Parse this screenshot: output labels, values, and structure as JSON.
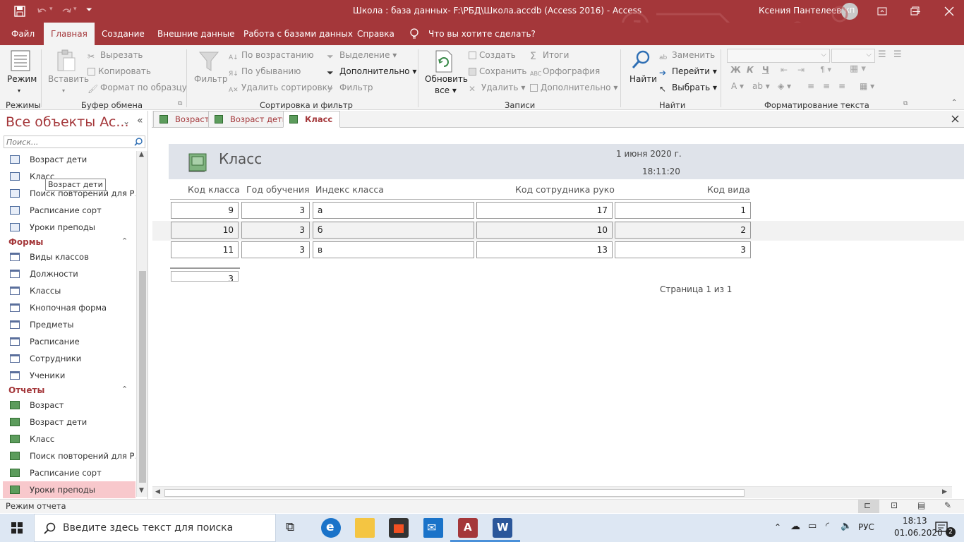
{
  "window": {
    "title": "Школа : база данных- F:\\РБД\\Школа.accdb (Access 2016)  -  Access",
    "user": "Ксения Пантелеева",
    "user_initials": "КП"
  },
  "ribbon_tabs": [
    "Файл",
    "Главная",
    "Создание",
    "Внешние данные",
    "Работа с базами данных",
    "Справка"
  ],
  "tell_me": "Что вы хотите сделать?",
  "ribbon": {
    "views": {
      "label": "Режим",
      "group": "Режимы"
    },
    "clipboard": {
      "paste": "Вставить",
      "cut": "Вырезать",
      "copy": "Копировать",
      "format_painter": "Формат по образцу",
      "group": "Буфер обмена"
    },
    "sort_filter": {
      "filter": "Фильтр",
      "asc": "По возрастанию",
      "desc": "По убыванию",
      "remove_sort": "Удалить сортировку",
      "selection": "Выделение",
      "advanced": "Дополнительно",
      "toggle_filter": "Фильтр",
      "group": "Сортировка и фильтр"
    },
    "records": {
      "refresh": "Обновить",
      "refresh2": "все",
      "new": "Создать",
      "save": "Сохранить",
      "delete": "Удалить",
      "totals": "Итоги",
      "spelling": "Орфография",
      "more": "Дополнительно",
      "group": "Записи"
    },
    "find": {
      "find": "Найти",
      "replace": "Заменить",
      "goto": "Перейти",
      "select": "Выбрать",
      "group": "Найти"
    },
    "text_format": {
      "group": "Форматирование текста",
      "bold": "Ж",
      "italic": "К",
      "underline": "Ч"
    }
  },
  "nav": {
    "title": "Все объекты Ac...",
    "search_placeholder": "Поиск...",
    "tooltip": "Возраст дети",
    "query_items": [
      "Возраст дети",
      "Класс",
      "Поиск повторений для Р...",
      "Расписание сорт",
      "Уроки преподы"
    ],
    "forms_header": "Формы",
    "form_items": [
      "Виды классов",
      "Должности",
      "Классы",
      "Кнопочная форма",
      "Предметы",
      "Расписание",
      "Сотрудники",
      "Ученики"
    ],
    "reports_header": "Отчеты",
    "report_items": [
      "Возраст",
      "Возраст дети",
      "Класс",
      "Поиск повторений для Р...",
      "Расписание сорт",
      "Уроки преподы"
    ]
  },
  "doc_tabs": [
    "Возраст",
    "Возраст дети",
    "Класс"
  ],
  "report": {
    "title": "Класс",
    "date": "1 июня 2020 г.",
    "time": "18:11:20",
    "columns": [
      "Код класса",
      "Год обучения",
      "Индекс класса",
      "Код сотрудника руко",
      "Код вида"
    ],
    "rows": [
      [
        "9",
        "3",
        "а",
        "17",
        "1"
      ],
      [
        "10",
        "3",
        "б",
        "10",
        "2"
      ],
      [
        "11",
        "3",
        "в",
        "13",
        "3"
      ]
    ],
    "count": "3",
    "page": "Страница 1 из 1"
  },
  "status": {
    "mode": "Режим отчета"
  },
  "taskbar": {
    "search": "Введите здесь текст для поиска",
    "lang": "РУС",
    "time": "18:13",
    "date": "01.06.2020",
    "notifications": "2"
  },
  "colors": {
    "accent": "#a4373a",
    "ribbon_bg": "#f3f3f3",
    "header_band": "#dfe3ea",
    "selected_nav": "#f8c8cc"
  }
}
